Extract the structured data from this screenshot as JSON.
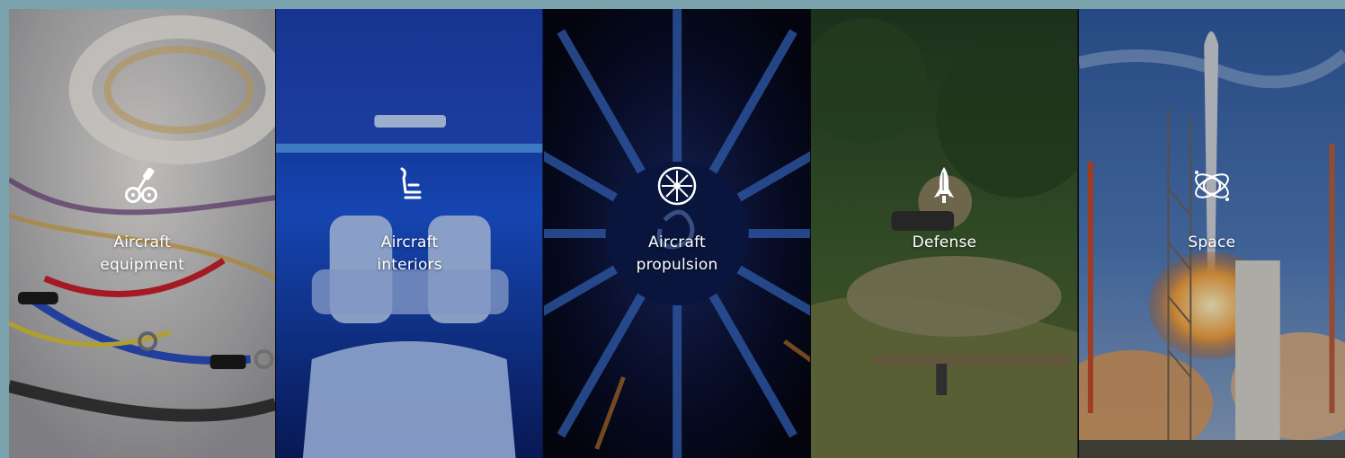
{
  "colors": {
    "page_border": "#7aa3ad",
    "label_text": "#ffffff",
    "frame_background": "#0a0f1e"
  },
  "tiles": [
    {
      "id": "aircraft-equipment",
      "label_line1": "Aircraft",
      "label_line2": "equipment",
      "icon": "landing-gear-icon",
      "background": "wiring-harness-image"
    },
    {
      "id": "aircraft-interiors",
      "label_line1": "Aircraft",
      "label_line2": "interiors",
      "icon": "seat-icon",
      "background": "cabin-interior-image"
    },
    {
      "id": "aircraft-propulsion",
      "label_line1": "Aircraft",
      "label_line2": "propulsion",
      "icon": "turbine-fan-icon",
      "background": "jet-engine-image"
    },
    {
      "id": "defense",
      "label_line1": "Defense",
      "label_line2": "",
      "icon": "missile-icon",
      "background": "soldier-binoculars-image"
    },
    {
      "id": "space",
      "label_line1": "Space",
      "label_line2": "",
      "icon": "orbit-icon",
      "background": "rocket-launch-image"
    }
  ]
}
